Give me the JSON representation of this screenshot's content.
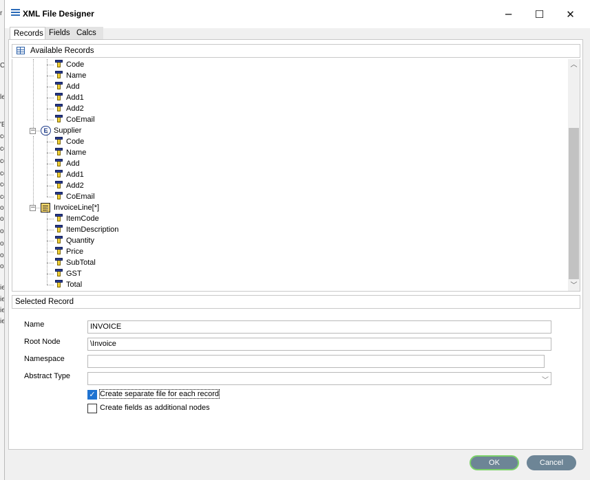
{
  "window": {
    "title": "XML File Designer",
    "minimize_glyph": "─",
    "maximize_glyph": "☐",
    "close_glyph": "✕"
  },
  "background": {
    "chars": [
      "r",
      "C",
      "le",
      "'E",
      "cc",
      "cc",
      "cc",
      "cc",
      "cc",
      "cc",
      "or",
      "or",
      "or",
      "or",
      "or",
      "or",
      "ie",
      "ie",
      "ie",
      "ie"
    ]
  },
  "tabs": [
    {
      "label": "Records",
      "active": true
    },
    {
      "label": "Fields",
      "active": false
    },
    {
      "label": "Calcs",
      "active": false
    }
  ],
  "available_records": {
    "header": "Available Records",
    "tree": [
      {
        "type": "field",
        "label": "Code"
      },
      {
        "type": "field",
        "label": "Name"
      },
      {
        "type": "field",
        "label": "Add"
      },
      {
        "type": "field",
        "label": "Add1"
      },
      {
        "type": "field",
        "label": "Add2"
      },
      {
        "type": "field",
        "label": "CoEmail"
      },
      {
        "type": "entity",
        "label": "Supplier",
        "icon_text": "E"
      },
      {
        "type": "field",
        "label": "Code"
      },
      {
        "type": "field",
        "label": "Name"
      },
      {
        "type": "field",
        "label": "Add"
      },
      {
        "type": "field",
        "label": "Add1"
      },
      {
        "type": "field",
        "label": "Add2"
      },
      {
        "type": "field",
        "label": "CoEmail"
      },
      {
        "type": "table",
        "label": "InvoiceLine[*]"
      },
      {
        "type": "field",
        "label": "ItemCode"
      },
      {
        "type": "field",
        "label": "ItemDescription"
      },
      {
        "type": "field",
        "label": "Quantity"
      },
      {
        "type": "field",
        "label": "Price"
      },
      {
        "type": "field",
        "label": "SubTotal"
      },
      {
        "type": "field",
        "label": "GST"
      },
      {
        "type": "field",
        "label": "Total"
      }
    ]
  },
  "selected_record": {
    "header": "Selected Record",
    "name_label": "Name",
    "name_value": "INVOICE",
    "root_node_label": "Root Node",
    "root_node_value": "\\Invoice",
    "namespace_label": "Namespace",
    "namespace_value": "",
    "abstract_type_label": "Abstract Type",
    "abstract_type_value": "",
    "separate_file_label": "Create separate file for each record",
    "separate_file_checked": true,
    "additional_nodes_label": "Create fields as additional nodes",
    "additional_nodes_checked": false
  },
  "buttons": {
    "ok": "OK",
    "cancel": "Cancel"
  },
  "colors": {
    "accent": "#1f73d1",
    "button": "#6d8596",
    "ok_focus": "#7cd16a"
  }
}
